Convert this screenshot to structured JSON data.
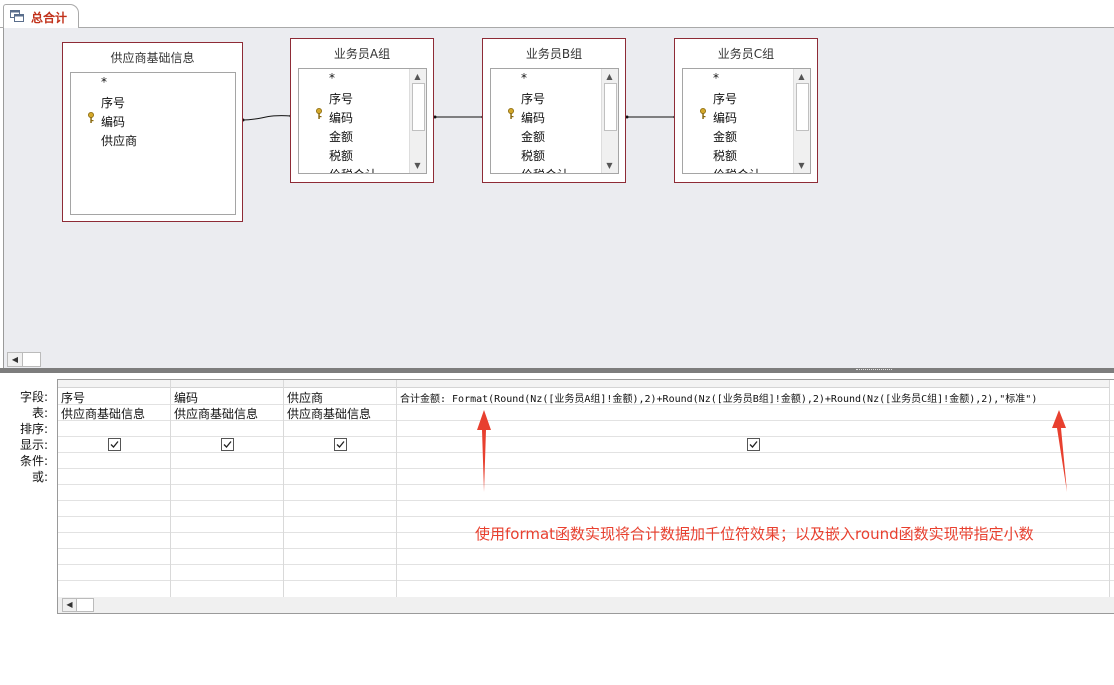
{
  "tab": {
    "label": "总合计",
    "icon": "query-icon"
  },
  "tables": [
    {
      "title": "供应商基础信息",
      "fields": [
        "*",
        "序号",
        "编码",
        "供应商"
      ],
      "key_field": "编码",
      "scrollbar": false
    },
    {
      "title": "业务员A组",
      "fields": [
        "*",
        "序号",
        "编码",
        "金额",
        "税额",
        "价税合计"
      ],
      "key_field": "编码",
      "scrollbar": true
    },
    {
      "title": "业务员B组",
      "fields": [
        "*",
        "序号",
        "编码",
        "金额",
        "税额",
        "价税合计"
      ],
      "key_field": "编码",
      "scrollbar": true
    },
    {
      "title": "业务员C组",
      "fields": [
        "*",
        "序号",
        "编码",
        "金额",
        "税额",
        "价税合计"
      ],
      "key_field": "编码",
      "scrollbar": true
    }
  ],
  "row_labels": [
    "字段:",
    "表:",
    "排序:",
    "显示:",
    "条件:",
    "或:"
  ],
  "columns": [
    {
      "field": "序号",
      "table": "供应商基础信息",
      "show": true
    },
    {
      "field": "编码",
      "table": "供应商基础信息",
      "show": true
    },
    {
      "field": "供应商",
      "table": "供应商基础信息",
      "show": true
    },
    {
      "field": "合计金额: Format(Round(Nz([业务员A组]!金额),2)+Round(Nz([业务员B组]!金额),2)+Round(Nz([业务员C组]!金额),2),\"标准\")",
      "table": "",
      "show": true
    }
  ],
  "annotation": {
    "text": "使用format函数实现将合计数据加千位符效果；以及嵌入round函数实现带指定小数",
    "color": "#e8402f"
  },
  "colors": {
    "table_border": "#8e2b36",
    "tab_text": "#c1311a",
    "designer_bg": "#ebecf0"
  }
}
